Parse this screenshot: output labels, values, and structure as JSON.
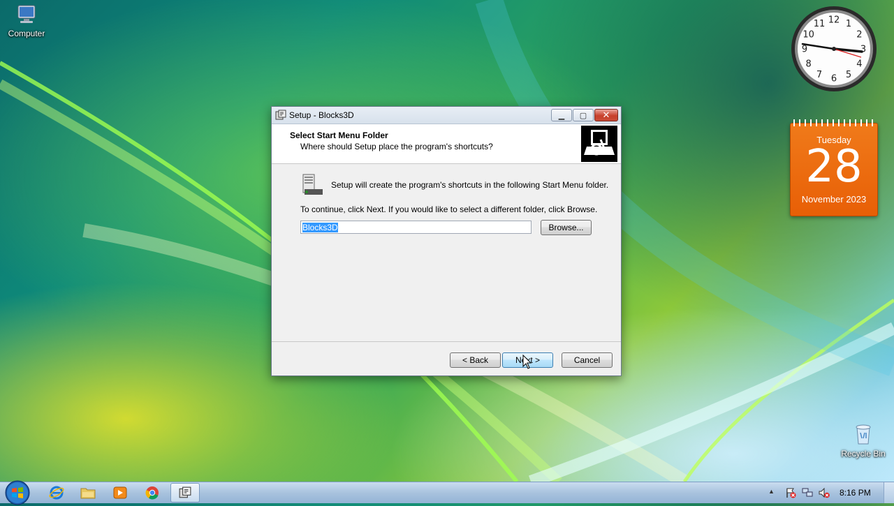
{
  "desktop": {
    "icons": [
      {
        "label": "Computer"
      },
      {
        "label": "Recycle Bin"
      }
    ]
  },
  "calendar_gadget": {
    "weekday": "Tuesday",
    "day": "28",
    "month_year": "November 2023"
  },
  "clock_gadget": {
    "numerals": [
      "12",
      "1",
      "2",
      "3",
      "4",
      "5",
      "6",
      "7",
      "8",
      "9",
      "10",
      "11"
    ]
  },
  "dialog": {
    "title": "Setup - Blocks3D",
    "header_title": "Select Start Menu Folder",
    "header_subtitle": "Where should Setup place the program's shortcuts?",
    "info_text": "Setup will create the program's shortcuts in the following Start Menu folder.",
    "continue_text": "To continue, click Next. If you would like to select a different folder, click Browse.",
    "folder_value": "Blocks3D",
    "browse_label": "Browse...",
    "back_label": "< Back",
    "next_label": "Next >",
    "cancel_label": "Cancel"
  },
  "taskbar": {
    "time": "8:16 PM",
    "pinned": [
      "internet-explorer-icon",
      "windows-explorer-icon",
      "media-player-icon",
      "chrome-icon",
      "setup-icon"
    ]
  },
  "colors": {
    "calendar_orange": "#e85f06",
    "selection_blue": "#3399ff",
    "close_red": "#c8402c"
  }
}
